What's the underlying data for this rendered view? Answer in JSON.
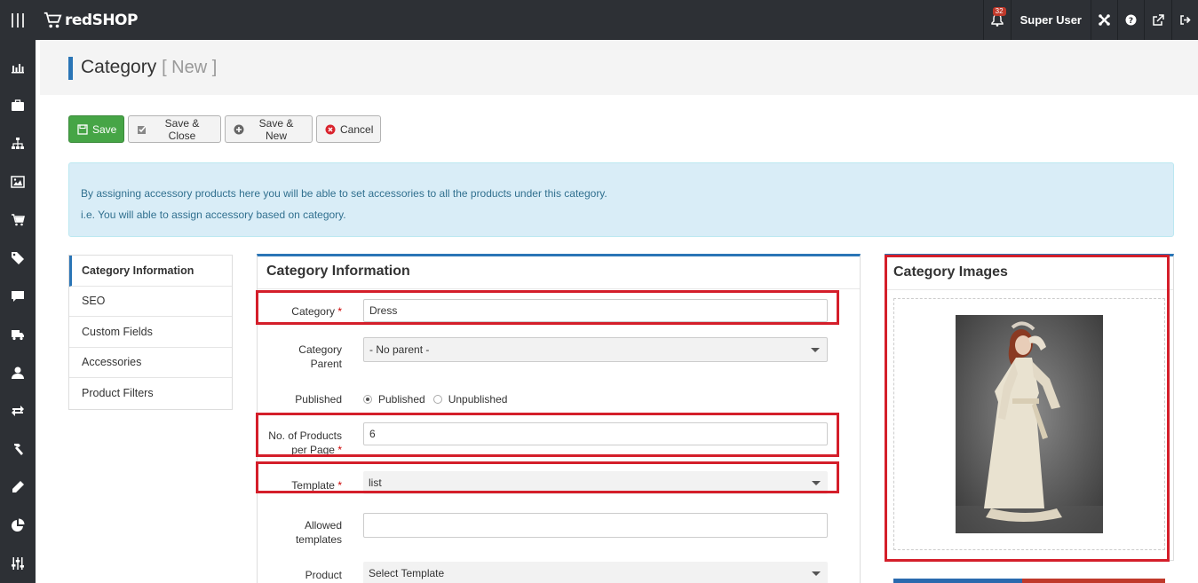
{
  "app": {
    "brand": "redSHOP",
    "notification_count": "32",
    "user_name": "Super User"
  },
  "topbar_icons": [
    "bell-icon",
    "joomla-icon",
    "help-icon",
    "external-link-icon",
    "logout-icon"
  ],
  "sidebar_icons": [
    "dashboard-chart-icon",
    "briefcase-icon",
    "sitemap-icon",
    "image-icon",
    "cart-icon",
    "tag-icon",
    "comment-icon",
    "truck-icon",
    "user-icon",
    "exchange-icon",
    "hammer-icon",
    "pencil-icon",
    "pie-chart-icon",
    "sliders-icon"
  ],
  "header": {
    "title": "Category",
    "subtitle": "[ New ]"
  },
  "toolbar": {
    "save": "Save",
    "save_close": "Save & Close",
    "save_new": "Save & New",
    "cancel": "Cancel"
  },
  "alert": {
    "line1": "By assigning accessory products here you will be able to set accessories to all the products under this category.",
    "line2": "i.e. You will able to assign accessory based on category."
  },
  "tabs": [
    {
      "label": "Category Information",
      "active": true
    },
    {
      "label": "SEO",
      "active": false
    },
    {
      "label": "Custom Fields",
      "active": false
    },
    {
      "label": "Accessories",
      "active": false
    },
    {
      "label": "Product Filters",
      "active": false
    }
  ],
  "form": {
    "title": "Category Information",
    "category_label": "Category",
    "category_value": "Dress",
    "parent_label_1": "Category",
    "parent_label_2": "Parent",
    "parent_value": "- No parent -",
    "published_label": "Published",
    "published_option": "Published",
    "unpublished_option": "Unpublished",
    "published_selected": "Published",
    "products_label_1": "No. of Products",
    "products_label_2": "per Page",
    "products_value": "6",
    "template_label": "Template",
    "template_value": "list",
    "allowed_label_1": "Allowed",
    "allowed_label_2": "templates",
    "allowed_value": "",
    "product_label": "Product",
    "product_template_value": "Select Template",
    "required_mark": "*"
  },
  "images_panel": {
    "title": "Category Images"
  },
  "colors": {
    "topbar": "#2d3035",
    "accent_blue": "#2a75b6",
    "save_green": "#46a546",
    "highlight_red": "#d41e2a",
    "alert_bg": "#d9edf7"
  }
}
